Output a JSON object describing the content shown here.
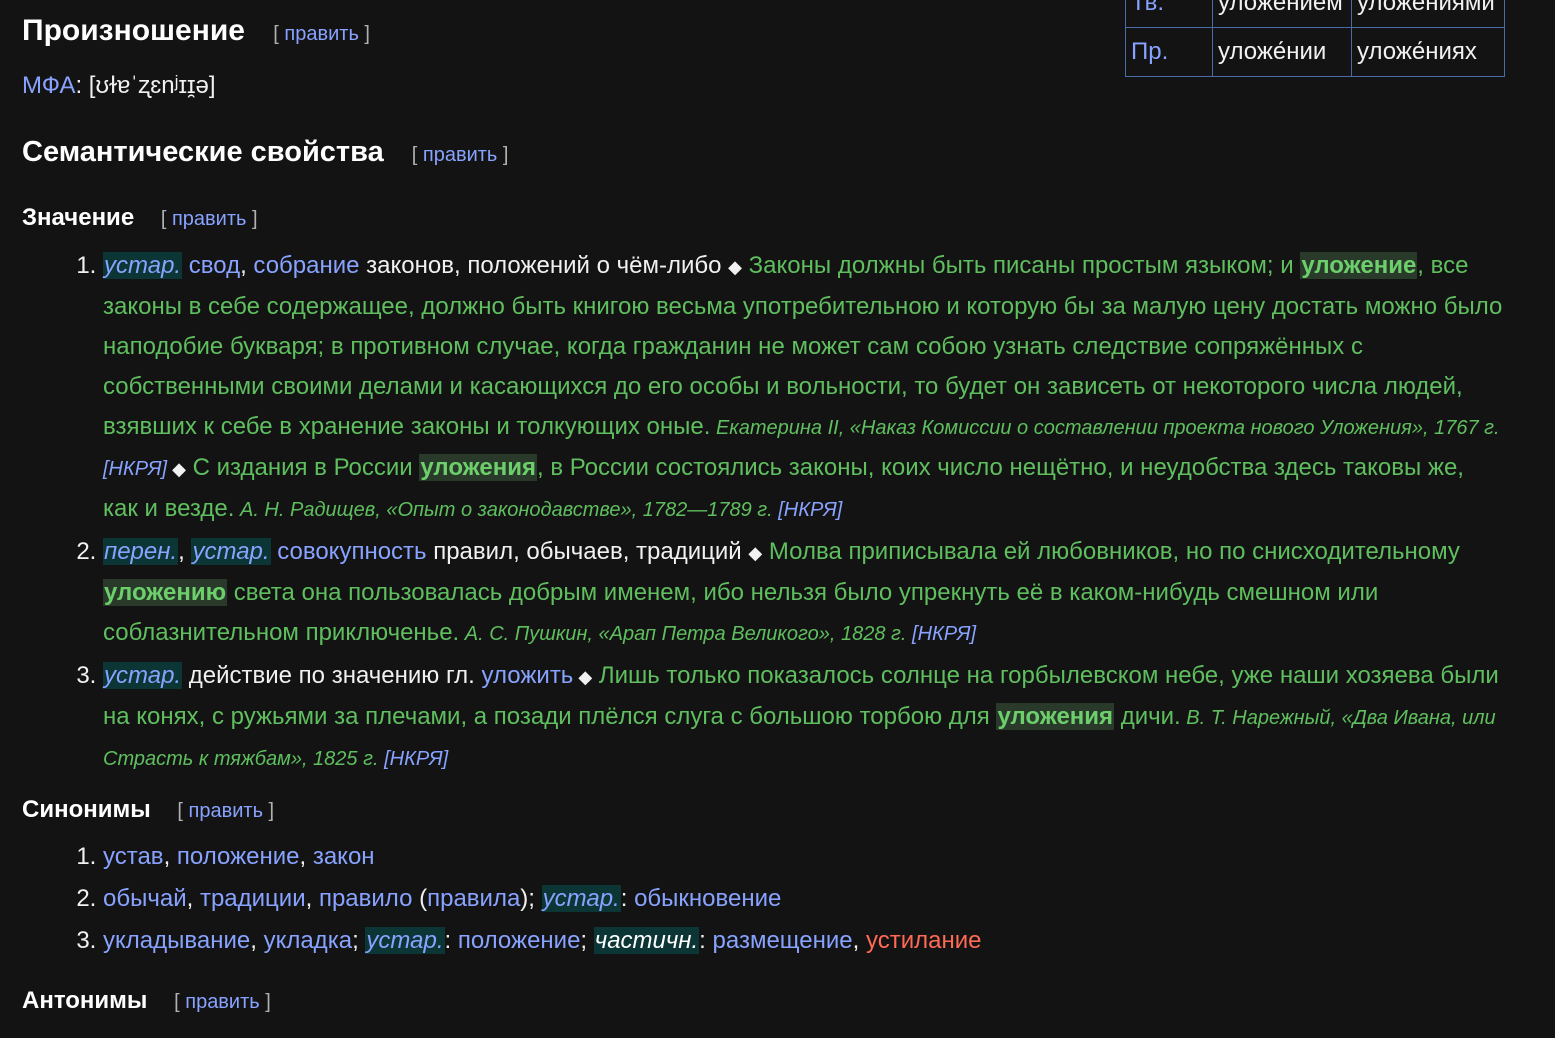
{
  "table": {
    "rows": [
      {
        "case": "Тв.",
        "sg": "уложением",
        "pl": "уложениями"
      },
      {
        "case": "Пр.",
        "sg": "уложе́нии",
        "pl": "уложе́ниях"
      }
    ]
  },
  "pron": {
    "title": "Произношение",
    "edit": "править",
    "ipa_label": "МФА",
    "ipa_value": ": [ʊɫɐˈʐɛnʲɪɪ̯ə]"
  },
  "semantic": {
    "title": "Семантические свойства",
    "edit": "править"
  },
  "meaning": {
    "title": "Значение",
    "edit": "править",
    "d1": {
      "lab": "устар.",
      "w1": "свод",
      "sep1": ", ",
      "w2": "собрание",
      "rest": " законов, положений о чём-либо ",
      "dia": "◆",
      "ex1a": " Законы должны быть писаны простым языком; и ",
      "ex1hl": "уложение",
      "ex1b": ", все законы в себе содержащее, должно быть книгою весьма употребительною и которую бы за малую цену достать можно было наподобие букваря; в противном случае, когда гражданин не может сам собою узнать следствие сопряжённых с собственными своими делами и касающихся до его особы и вольности, то будет он зависеть от некоторого числа людей, взявших к себе в хранение законы и толкующих оные.",
      "src1": " Екатерина II, «Наказ Комиссии о составлении проекта нового Уложения», 1767 г. ",
      "ncr1": "[НКРЯ]",
      "dia2": " ◆",
      "ex2a": " С издания в России ",
      "ex2hl": "уложения",
      "ex2b": ", в России состоялись законы, коих число нещётно, и неудобства здесь таковы же, как и везде.",
      "src2": " А. Н. Радищев, «Опыт о законодавстве», 1782—1789 г. ",
      "ncr2": "[НКРЯ]"
    },
    "d2": {
      "lab1": "перен.",
      "comma": ", ",
      "lab2": "устар.",
      "w1": "совокупность",
      "rest": " правил, обычаев, традиций ",
      "dia": "◆",
      "exa": " Молва приписывала ей любовников, но по снисходительному ",
      "exhl": "уложению",
      "exb": " света она пользовалась добрым именем, ибо нельзя было упрекнуть её в каком-нибудь смешном или соблазнительном приключенье.",
      "src": " А. С. Пушкин, «Арап Петра Великого», 1828 г. ",
      "ncr": "[НКРЯ]"
    },
    "d3": {
      "lab": "устар.",
      "rest": " действие по значению гл. ",
      "w1": "уложить",
      "dia": " ◆",
      "exa": " Лишь только показалось солнце на горбылевском небе, уже наши хозяева были на конях, с ружьями за плечами, а позади плёлся слуга с большою торбою для ",
      "exhl": "уложения",
      "exb": " дичи.",
      "src": " В. Т. Нарежный, «Два Ивана, или Страсть к тяжбам», 1825 г. ",
      "ncr": "[НКРЯ]"
    }
  },
  "synonyms": {
    "title": "Синонимы",
    "edit": "править",
    "s1": [
      "устав",
      "положение",
      "закон"
    ],
    "s2": {
      "w1": "обычай",
      "w2": "традиции",
      "w3": "правило",
      "w3b": "правила",
      "lab": "устар.",
      "w4": "обыкновение"
    },
    "s3": {
      "w1": "укладывание",
      "w2": "укладка",
      "lab": "устар.",
      "w3": "положение",
      "lab2": "частичн.",
      "w4": "размещение",
      "w5": "устилание"
    }
  },
  "antonyms": {
    "title": "Антонимы",
    "edit": "править"
  },
  "colors": {
    "link": "#88a3ff",
    "red_link": "#ff6a55",
    "example": "#5fbf5f",
    "background": "#131313"
  }
}
